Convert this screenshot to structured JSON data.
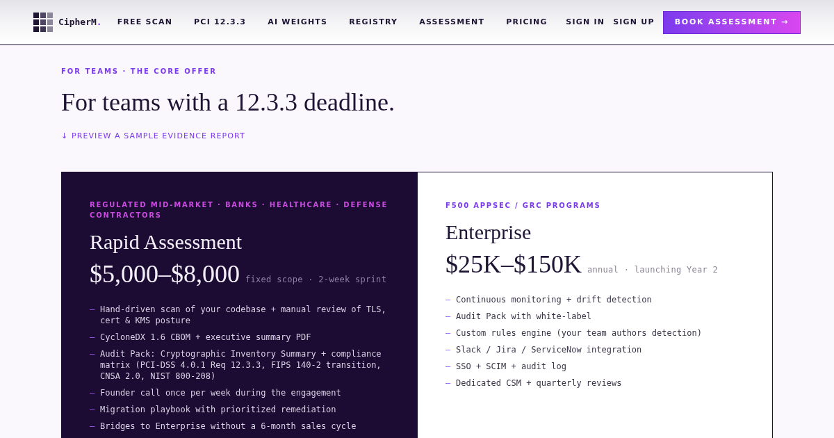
{
  "header": {
    "logo": {
      "name": "CipherM",
      "accent": "."
    },
    "nav": [
      "FREE SCAN",
      "PCI 12.3.3",
      "AI WEIGHTS",
      "REGISTRY",
      "ASSESSMENT",
      "PRICING"
    ],
    "auth": [
      "SIGN IN",
      "SIGN UP"
    ],
    "cta": "BOOK ASSESSMENT →"
  },
  "intro": {
    "eyebrow": "FOR TEAMS · THE CORE OFFER",
    "title": "For teams with a 12.3.3 deadline.",
    "link": "↓ PREVIEW A SAMPLE EVIDENCE REPORT"
  },
  "plans": [
    {
      "kind": "dark",
      "eyebrow": "REGULATED MID-MARKET · BANKS · HEALTHCARE · DEFENSE CONTRACTORS",
      "name": "Rapid Assessment",
      "price": "$5,000–$8,000",
      "terms": "fixed scope · 2-week sprint",
      "features": [
        {
          "marker": "—",
          "text": "Hand-driven scan of your codebase + manual review of TLS, cert & KMS posture"
        },
        {
          "marker": "—",
          "text": "CycloneDX 1.6 CBOM + executive summary PDF"
        },
        {
          "marker": "—",
          "text": "Audit Pack: Cryptographic Inventory Summary + compliance matrix (PCI-DSS 4.0.1 Req 12.3.3, FIPS 140-2 transition, CNSA 2.0, NIST 800-208)"
        },
        {
          "marker": "—",
          "text": "Founder call once per week during the engagement"
        },
        {
          "marker": "—",
          "text": "Migration playbook with prioritized remediation"
        },
        {
          "marker": "—",
          "text": "Bridges to Enterprise without a 6-month sales cycle"
        }
      ]
    },
    {
      "kind": "light",
      "eyebrow": "F500 APPSEC / GRC PROGRAMS",
      "name": "Enterprise",
      "price": "$25K–$150K",
      "terms": "annual · launching Year 2",
      "features": [
        {
          "marker": "—",
          "text": "Continuous monitoring + drift detection"
        },
        {
          "marker": "—",
          "text": "Audit Pack with white-label"
        },
        {
          "marker": "—",
          "text": "Custom rules engine (your team authors detection)"
        },
        {
          "marker": "—",
          "text": "Slack / Jira / ServiceNow integration"
        },
        {
          "marker": "—",
          "text": "SSO + SCIM + audit log"
        },
        {
          "marker": "—",
          "text": "Dedicated CSM + quarterly reviews"
        }
      ]
    }
  ]
}
